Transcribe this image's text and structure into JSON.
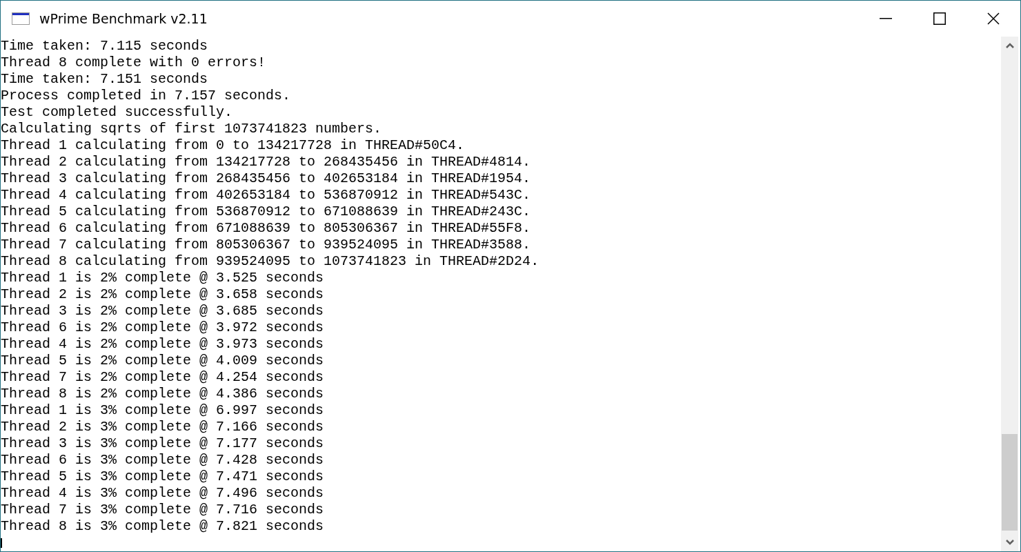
{
  "window": {
    "title": "wPrime Benchmark v2.11"
  },
  "log_lines": [
    "Time taken: 7.115 seconds",
    "Thread 8 complete with 0 errors!",
    "Time taken: 7.151 seconds",
    "Process completed in 7.157 seconds.",
    "Test completed successfully.",
    "Calculating sqrts of first 1073741823 numbers.",
    "Thread 1 calculating from 0 to 134217728 in THREAD#50C4.",
    "Thread 2 calculating from 134217728 to 268435456 in THREAD#4814.",
    "Thread 3 calculating from 268435456 to 402653184 in THREAD#1954.",
    "Thread 4 calculating from 402653184 to 536870912 in THREAD#543C.",
    "Thread 5 calculating from 536870912 to 671088639 in THREAD#243C.",
    "Thread 6 calculating from 671088639 to 805306367 in THREAD#55F8.",
    "Thread 7 calculating from 805306367 to 939524095 in THREAD#3588.",
    "Thread 8 calculating from 939524095 to 1073741823 in THREAD#2D24.",
    "Thread 1 is 2% complete @ 3.525 seconds",
    "Thread 2 is 2% complete @ 3.658 seconds",
    "Thread 3 is 2% complete @ 3.685 seconds",
    "Thread 6 is 2% complete @ 3.972 seconds",
    "Thread 4 is 2% complete @ 3.973 seconds",
    "Thread 5 is 2% complete @ 4.009 seconds",
    "Thread 7 is 2% complete @ 4.254 seconds",
    "Thread 8 is 2% complete @ 4.386 seconds",
    "Thread 1 is 3% complete @ 6.997 seconds",
    "Thread 2 is 3% complete @ 7.166 seconds",
    "Thread 3 is 3% complete @ 7.177 seconds",
    "Thread 6 is 3% complete @ 7.428 seconds",
    "Thread 5 is 3% complete @ 7.471 seconds",
    "Thread 4 is 3% complete @ 7.496 seconds",
    "Thread 7 is 3% complete @ 7.716 seconds",
    "Thread 8 is 3% complete @ 7.821 seconds"
  ]
}
